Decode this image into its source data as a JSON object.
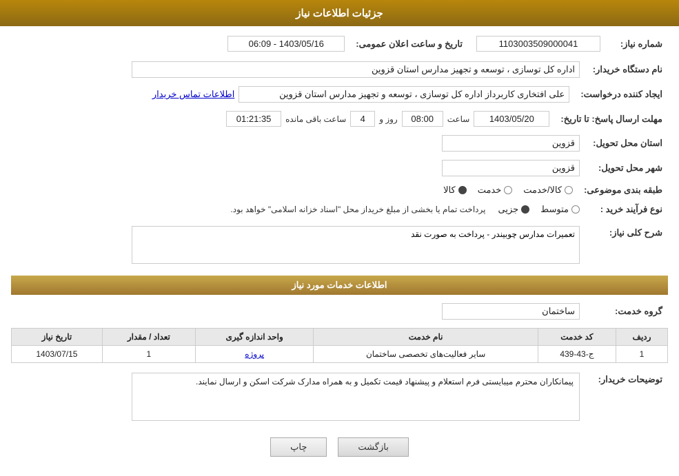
{
  "header": {
    "title": "جزئیات اطلاعات نیاز"
  },
  "fields": {
    "need_number_label": "شماره نیاز:",
    "need_number_value": "1103003509000041",
    "buyer_org_label": "نام دستگاه خریدار:",
    "buyer_org_value": "اداره کل توسازی ، توسعه و تجهیز مدارس استان قزوین",
    "creator_label": "ایجاد کننده درخواست:",
    "creator_value": "علی افتخاری کاربرداز اداره کل توسازی ، توسعه و تجهیز مدارس استان قزوین",
    "contact_link": "اطلاعات تماس خریدار",
    "deadline_label": "مهلت ارسال پاسخ: تا تاریخ:",
    "deadline_date": "1403/05/20",
    "deadline_time_label": "ساعت",
    "deadline_time": "08:00",
    "deadline_days_label": "روز و",
    "deadline_days": "4",
    "deadline_remaining_label": "ساعت باقی مانده",
    "deadline_remaining": "01:21:35",
    "delivery_province_label": "استان محل تحویل:",
    "delivery_province_value": "قزوین",
    "delivery_city_label": "شهر محل تحویل:",
    "delivery_city_value": "قزوین",
    "category_label": "طبقه بندی موضوعی:",
    "category_options": [
      "کالا",
      "خدمت",
      "کالا/خدمت"
    ],
    "category_selected": "کالا",
    "procurement_label": "نوع فرآیند خرید :",
    "procurement_options": [
      "جزیی",
      "متوسط"
    ],
    "procurement_desc": "پرداخت تمام یا بخشی از مبلغ خریداز محل \"اسناد خزانه اسلامی\" خواهد بود.",
    "announce_label": "تاریخ و ساعت اعلان عمومی:",
    "announce_value": "1403/05/16 - 06:09",
    "need_desc_label": "شرح کلی نیاز:",
    "need_desc_value": "تعمیرات مدارس چوبیندر - پرداخت به صورت نقد",
    "services_title": "اطلاعات خدمات مورد نیاز",
    "service_group_label": "گروه خدمت:",
    "service_group_value": "ساختمان",
    "table_headers": [
      "ردیف",
      "کد خدمت",
      "نام خدمت",
      "واحد اندازه گیری",
      "تعداد / مقدار",
      "تاریخ نیاز"
    ],
    "table_rows": [
      {
        "row": "1",
        "service_code": "ج-43-439",
        "service_name": "سایر فعالیت‌های تخصصی ساختمان",
        "unit": "پروژه",
        "quantity": "1",
        "date": "1403/07/15"
      }
    ],
    "buyer_notes_label": "توضیحات خریدار:",
    "buyer_notes_value": "پیمانکاران محترم میبایستی فرم استعلام و پیشنهاد قیمت تکمیل و به همراه مدارک شرکت اسکن و ارسال نمایند.",
    "btn_print": "چاپ",
    "btn_back": "بازگشت"
  }
}
